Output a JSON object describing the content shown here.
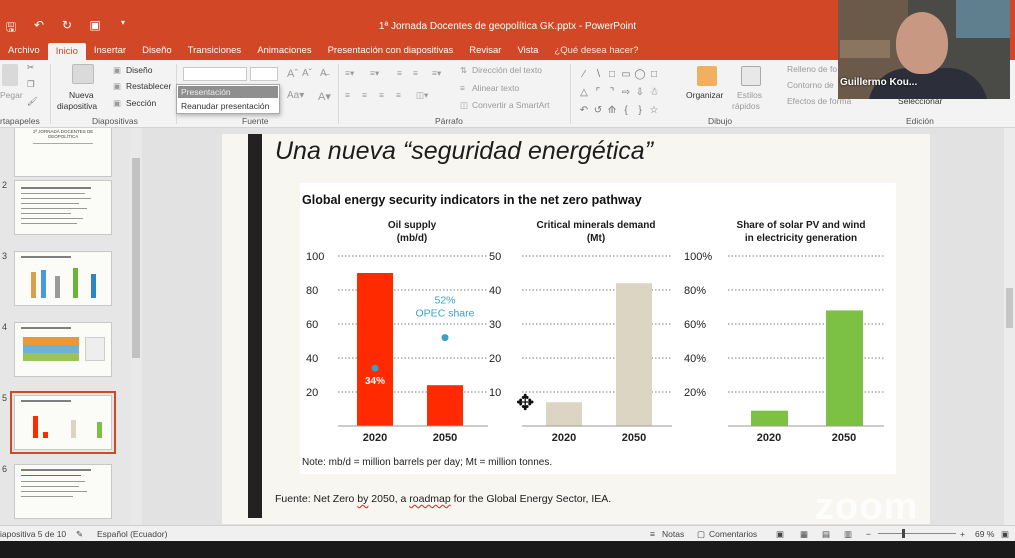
{
  "window": {
    "title": "1ª Jornada Docentes de geopolítica GK.pptx - PowerPoint"
  },
  "qat": {
    "save_icon": "save-icon",
    "undo_icon": "undo-icon",
    "redo_icon": "redo-icon",
    "present_icon": "present-icon"
  },
  "ribbon": {
    "tabs": [
      "Archivo",
      "Inicio",
      "Insertar",
      "Diseño",
      "Transiciones",
      "Animaciones",
      "Presentación con diapositivas",
      "Revisar",
      "Vista"
    ],
    "search": "¿Qué desea hacer?",
    "paste": "Pegar",
    "new_slide": "Nueva",
    "new_slide_2": "diapositiva",
    "layout": "Diseño",
    "reset": "Restablecer",
    "section": "Sección",
    "groups": {
      "clipboard": "rtapapeles",
      "slides": "Diapositivas",
      "font": "Fuente",
      "paragraph": "Párrafo",
      "drawing": "Dibujo",
      "editing": "Edición"
    },
    "text_direction": "Dirección del texto",
    "align_text": "Alinear texto",
    "convert_smartart": "Convertir a SmartArt",
    "organize": "Organizar",
    "quick_styles": "Estilos",
    "quick_styles_2": "rápidos",
    "shape_fill": "Relleno de fo",
    "shape_outline": "Contorno de",
    "shape_effects": "Efectos de forma",
    "select": "Seleccionar",
    "dropdown": {
      "selected": "Presentación",
      "option": "Reanudar presentación"
    }
  },
  "webcam": {
    "name": "Guillermo Kou..."
  },
  "thumbnails": {
    "numbers": [
      "2",
      "3",
      "4",
      "5",
      "6"
    ],
    "thumb1_title": "1ª JORNADA DOCENTES DE GEOPOLÍTICA"
  },
  "slide": {
    "title": "Una nueva “seguridad energética”",
    "figure_title": "Global energy security indicators in the net zero pathway",
    "note": "Note: mb/d = million barrels per day; Mt = million tonnes.",
    "source_pre": "Fuente: Net Zero ",
    "source_by": "by",
    "source_mid": " 2050, a ",
    "source_roadmap": "roadmap",
    "source_post": " for the Global Energy Sector, IEA."
  },
  "chart_data": [
    {
      "type": "bar",
      "title": "Oil supply",
      "subtitle": "(mb/d)",
      "categories": [
        "2020",
        "2050"
      ],
      "values": [
        90,
        24
      ],
      "ylim": [
        0,
        100
      ],
      "yticks": [
        "20",
        "40",
        "60",
        "80",
        "100"
      ],
      "color": "#ff2a00",
      "annotations": [
        {
          "label": "34%",
          "category": "2020",
          "value": 34
        },
        {
          "label": "52%",
          "label2": "OPEC share",
          "category": "2050",
          "value": 52
        }
      ],
      "annotation_color": "#3aa0c8"
    },
    {
      "type": "bar",
      "title": "Critical minerals demand",
      "subtitle": "(Mt)",
      "categories": [
        "2020",
        "2050"
      ],
      "values": [
        7,
        42
      ],
      "ylim": [
        0,
        50
      ],
      "yticks": [
        "10",
        "20",
        "30",
        "40",
        "50"
      ],
      "color": "#dcd5c3"
    },
    {
      "type": "bar",
      "title": "Share of solar PV and wind",
      "subtitle": "in electricity generation",
      "categories": [
        "2020",
        "2050"
      ],
      "values": [
        9,
        68
      ],
      "ylim": [
        0,
        100
      ],
      "yticks": [
        "20%",
        "40%",
        "60%",
        "80%",
        "100%"
      ],
      "color": "#7cc143"
    }
  ],
  "status": {
    "slide_info": "iapositiva 5 de 10",
    "language": "Español (Ecuador)",
    "notes": "Notas",
    "comments": "Comentarios",
    "zoom": "69 %"
  },
  "watermark": "zoom"
}
